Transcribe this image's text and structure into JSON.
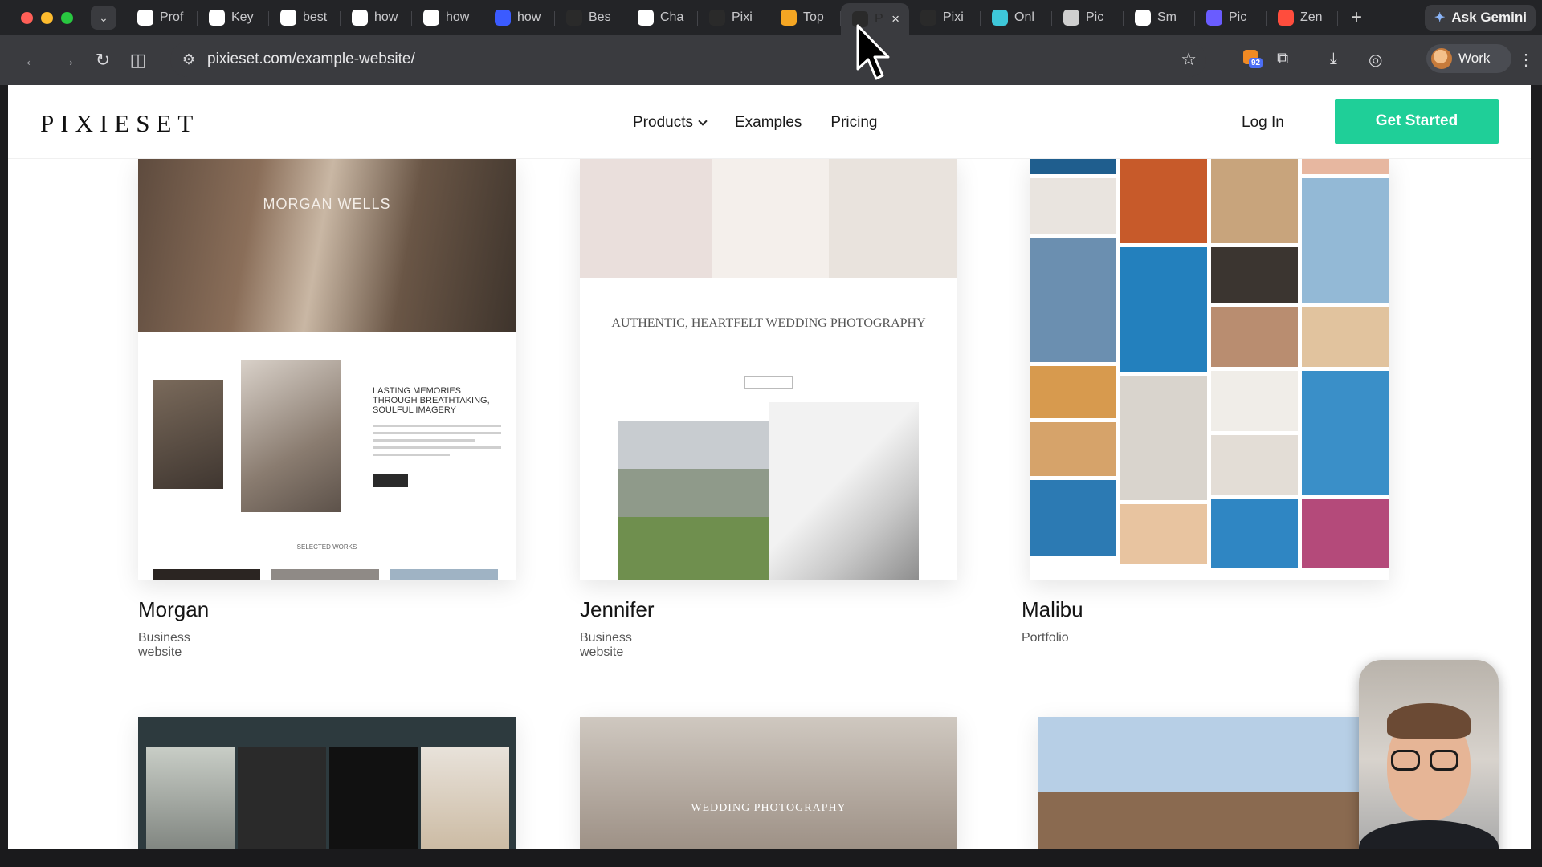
{
  "browser": {
    "tabs": [
      {
        "label": "Prof",
        "icon": "notion-icon",
        "color": "#ffffff"
      },
      {
        "label": "Key",
        "icon": "openai-icon",
        "color": "#ffffff"
      },
      {
        "label": "best",
        "icon": "google-icon",
        "color": "#ffffff"
      },
      {
        "label": "how",
        "icon": "google-icon",
        "color": "#ffffff"
      },
      {
        "label": "how",
        "icon": "google-icon",
        "color": "#ffffff"
      },
      {
        "label": "how",
        "icon": "zapier-icon",
        "color": "#3b5bff"
      },
      {
        "label": "Bes",
        "icon": "tool-icon",
        "color": "#2a2a2a"
      },
      {
        "label": "Cha",
        "icon": "openai-icon",
        "color": "#ffffff"
      },
      {
        "label": "Pixi",
        "icon": "pixieset-icon",
        "color": "#2a2a2a"
      },
      {
        "label": "Top",
        "icon": "a-icon",
        "color": "#f5a623"
      },
      {
        "label": "P",
        "icon": "pixieset-icon",
        "color": "#2a2a2a",
        "active": true
      },
      {
        "label": "Pixi",
        "icon": "pixieset-icon",
        "color": "#2a2a2a"
      },
      {
        "label": "Onl",
        "icon": "canva-icon",
        "color": "#3ec7d9"
      },
      {
        "label": "Pic",
        "icon": "pic-icon",
        "color": "#cfcfcf"
      },
      {
        "label": "Sm",
        "icon": "smile-icon",
        "color": "#ffffff"
      },
      {
        "label": "Pic",
        "icon": "pic-blue-icon",
        "color": "#6a5cff"
      },
      {
        "label": "Zen",
        "icon": "zen-icon",
        "color": "#ff4d3d"
      }
    ],
    "ask_gemini": "Ask Gemini",
    "url": "pixieset.com/example-website/",
    "extension_badge": "92",
    "profile_label": "Work"
  },
  "site": {
    "logo": "PIXIESET",
    "nav": {
      "products": "Products",
      "examples": "Examples",
      "pricing": "Pricing"
    },
    "login": "Log In",
    "cta": "Get Started"
  },
  "cards": [
    {
      "title": "Morgan",
      "subtitle": "Business website"
    },
    {
      "title": "Jennifer",
      "subtitle": "Business website"
    },
    {
      "title": "Malibu",
      "subtitle": "Portfolio"
    }
  ],
  "thumbs": {
    "morgan_name": "MORGAN WELLS",
    "morgan_heading": "LASTING MEMORIES THROUGH BREATHTAKING, SOULFUL IMAGERY",
    "morgan_selected": "SELECTED WORKS",
    "jennifer_heading": "AUTHENTIC, HEARTFELT WEDDING PHOTOGRAPHY",
    "row2_middle": "WEDDING PHOTOGRAPHY"
  }
}
